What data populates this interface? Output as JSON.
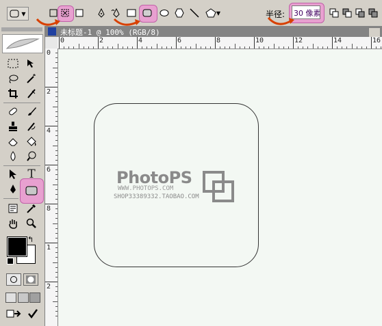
{
  "options_bar": {
    "radius_label": "半径:",
    "radius_value": "30 像素",
    "highlight_color": "#e8a0d0"
  },
  "document": {
    "title": "未标题-1 @ 100% (RGB/8)"
  },
  "rulers": {
    "horizontal": [
      "0",
      "2",
      "4",
      "6",
      "8",
      "10",
      "12",
      "14",
      "16"
    ],
    "vertical": [
      "0",
      "2",
      "4",
      "6",
      "8",
      "1",
      "2"
    ]
  },
  "watermark": {
    "brand": "PhotoPS",
    "url": "WWW.PHOTOPS.COM",
    "shop": "SHOP33389332.TAOBAO.COM"
  },
  "tools": {
    "text_tool_glyph": "T"
  },
  "icons": [
    "rounded-rect-preset-icon",
    "shape-layers-icon",
    "paths-icon",
    "fill-pixels-icon",
    "pen-icon",
    "freeform-pen-icon",
    "rectangle-icon",
    "rounded-rectangle-icon",
    "ellipse-icon",
    "polygon-icon",
    "line-icon",
    "custom-shape-icon"
  ]
}
